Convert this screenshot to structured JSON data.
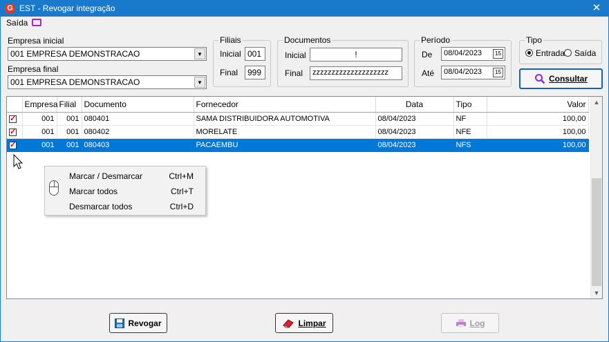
{
  "window": {
    "title": "EST - Revogar integração",
    "close": "✕",
    "icon": "G"
  },
  "menu": {
    "saida": "Saída"
  },
  "empresa": {
    "inicial_label": "Empresa inicial",
    "inicial_value": "001 EMPRESA DEMONSTRACAO",
    "final_label": "Empresa final",
    "final_value": "001 EMPRESA DEMONSTRACAO"
  },
  "filiais": {
    "legend": "Filiais",
    "inicial_label": "Inicial",
    "inicial_value": "001",
    "final_label": "Final",
    "final_value": "999"
  },
  "documentos": {
    "legend": "Documentos",
    "inicial_label": "Inicial",
    "inicial_value": "!",
    "final_label": "Final",
    "final_value": "zzzzzzzzzzzzzzzzzzzz"
  },
  "periodo": {
    "legend": "Período",
    "de_label": "De",
    "de_value": "08/04/2023",
    "ate_label": "Até",
    "ate_value": "08/04/2023",
    "cal_icon": "15"
  },
  "tipo": {
    "legend": "Tipo",
    "entrada": "Entrada",
    "saida": "Saída",
    "selected": "Entrada"
  },
  "consultar": "Consultar",
  "grid": {
    "columns": [
      "",
      "Empresa",
      "Filial",
      "Documento",
      "Fornecedor",
      "Data",
      "Tipo",
      "Valor"
    ],
    "rows": [
      {
        "checked": true,
        "empresa": "001",
        "filial": "001",
        "documento": "080401",
        "fornecedor": "SAMA DISTRIBUIDORA AUTOMOTIVA",
        "data": "08/04/2023",
        "tipo": "NF",
        "valor": "100,00",
        "selected": false
      },
      {
        "checked": true,
        "empresa": "001",
        "filial": "001",
        "documento": "080402",
        "fornecedor": "MORELATE",
        "data": "08/04/2023",
        "tipo": "NFE",
        "valor": "100,00",
        "selected": false
      },
      {
        "checked": true,
        "empresa": "001",
        "filial": "001",
        "documento": "080403",
        "fornecedor": "PACAEMBU",
        "data": "08/04/2023",
        "tipo": "NFS",
        "valor": "100,00",
        "selected": true
      }
    ]
  },
  "context_menu": {
    "items": [
      {
        "label": "Marcar / Desmarcar",
        "shortcut": "Ctrl+M"
      },
      {
        "label": "Marcar todos",
        "shortcut": "Ctrl+T"
      },
      {
        "label": "Desmarcar todos",
        "shortcut": "Ctrl+D"
      }
    ]
  },
  "buttons": {
    "revogar": "Revogar",
    "limpar": "Limpar",
    "log": "Log"
  },
  "colors": {
    "titlebar": "#1979ca",
    "selection": "#0078d7",
    "accent_purple": "#b020c8",
    "check_red": "#d00000"
  }
}
